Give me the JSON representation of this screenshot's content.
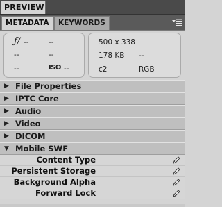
{
  "preview_tab": {
    "label": "PREVIEW"
  },
  "tabs": [
    {
      "label": "METADATA",
      "active": true
    },
    {
      "label": "KEYWORDS",
      "active": false
    }
  ],
  "panel_menu_icon": "panel-menu-icon",
  "camera_summary": {
    "fstop_icon_text": "ƒ/",
    "fstop_value": "--",
    "shutter_value": "--",
    "row2_left": "--",
    "row2_right": "--",
    "row3_left": "--",
    "iso_icon_text": "ISO",
    "iso_value": "--"
  },
  "file_summary": {
    "dimensions": "500 x 338",
    "file_size": "178 KB",
    "row2_right": "--",
    "color_profile": "c2",
    "color_mode": "RGB"
  },
  "categories": [
    {
      "label": "File Properties",
      "expanded": false
    },
    {
      "label": "IPTC Core",
      "expanded": false
    },
    {
      "label": "Audio",
      "expanded": false
    },
    {
      "label": "Video",
      "expanded": false
    },
    {
      "label": "DICOM",
      "expanded": false
    },
    {
      "label": "Mobile SWF",
      "expanded": true
    }
  ],
  "mobile_swf_fields": [
    {
      "label": "Content Type"
    },
    {
      "label": "Persistent Storage"
    },
    {
      "label": "Background Alpha"
    },
    {
      "label": "Forward Lock"
    }
  ],
  "colors": {
    "panel_bg": "#d4d4d4",
    "category_bg": "#bfbfbf",
    "tab_bar_bg": "#5a5a5a"
  }
}
